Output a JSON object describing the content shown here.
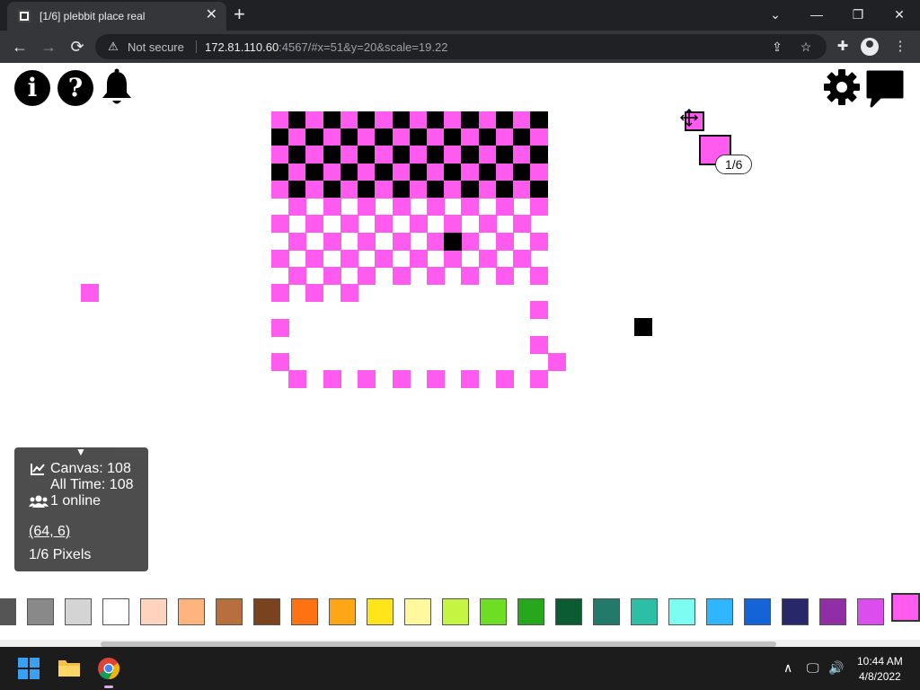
{
  "browser": {
    "tab_title": "[1/6] plebbit place real",
    "tab_close": "✕",
    "new_tab": "+",
    "window_controls": {
      "minimize": "—",
      "restore": "❐",
      "close": "✕",
      "tab_list": "⌄"
    },
    "nav": {
      "back": "←",
      "forward": "→",
      "reload": "⟳"
    },
    "security_label": "Not secure",
    "url_host": "172.81.110.60",
    "url_rest": ":4567/#x=51&y=20&scale=19.22",
    "icons": [
      "warning-icon",
      "share-icon",
      "star-icon",
      "extensions-icon",
      "profile-icon",
      "menu-icon"
    ]
  },
  "app": {
    "info_label": "i",
    "help_label": "?",
    "stats": {
      "canvas": "Canvas: 108",
      "all_time": "All Time: 108",
      "online": "1 online",
      "coords": "(64, 6)",
      "pixels": "1/6 Pixels"
    },
    "pixel_counter": "1/6",
    "selected_color": "#ff5bef",
    "pixel_colors": {
      "pink": "#ff5bef",
      "black": "#000000"
    },
    "palette": [
      "#555555",
      "#898989",
      "#d4d4d4",
      "#ffffff",
      "#ffd3bd",
      "#ffb480",
      "#b86f3e",
      "#7a4320",
      "#ff7212",
      "#ffa616",
      "#ffe519",
      "#fff89e",
      "#c5f542",
      "#6ede24",
      "#27a81c",
      "#0c5c33",
      "#237a6b",
      "#2dbfa6",
      "#7dfcf2",
      "#30b6ff",
      "#1463d9",
      "#27276a",
      "#902ea6",
      "#dc4ded",
      "#ff5bef"
    ]
  },
  "taskbar": {
    "time": "10:44 AM",
    "date": "4/8/2022",
    "tray": {
      "chevron": "∧",
      "network": "🖵",
      "volume": "🔊"
    }
  }
}
